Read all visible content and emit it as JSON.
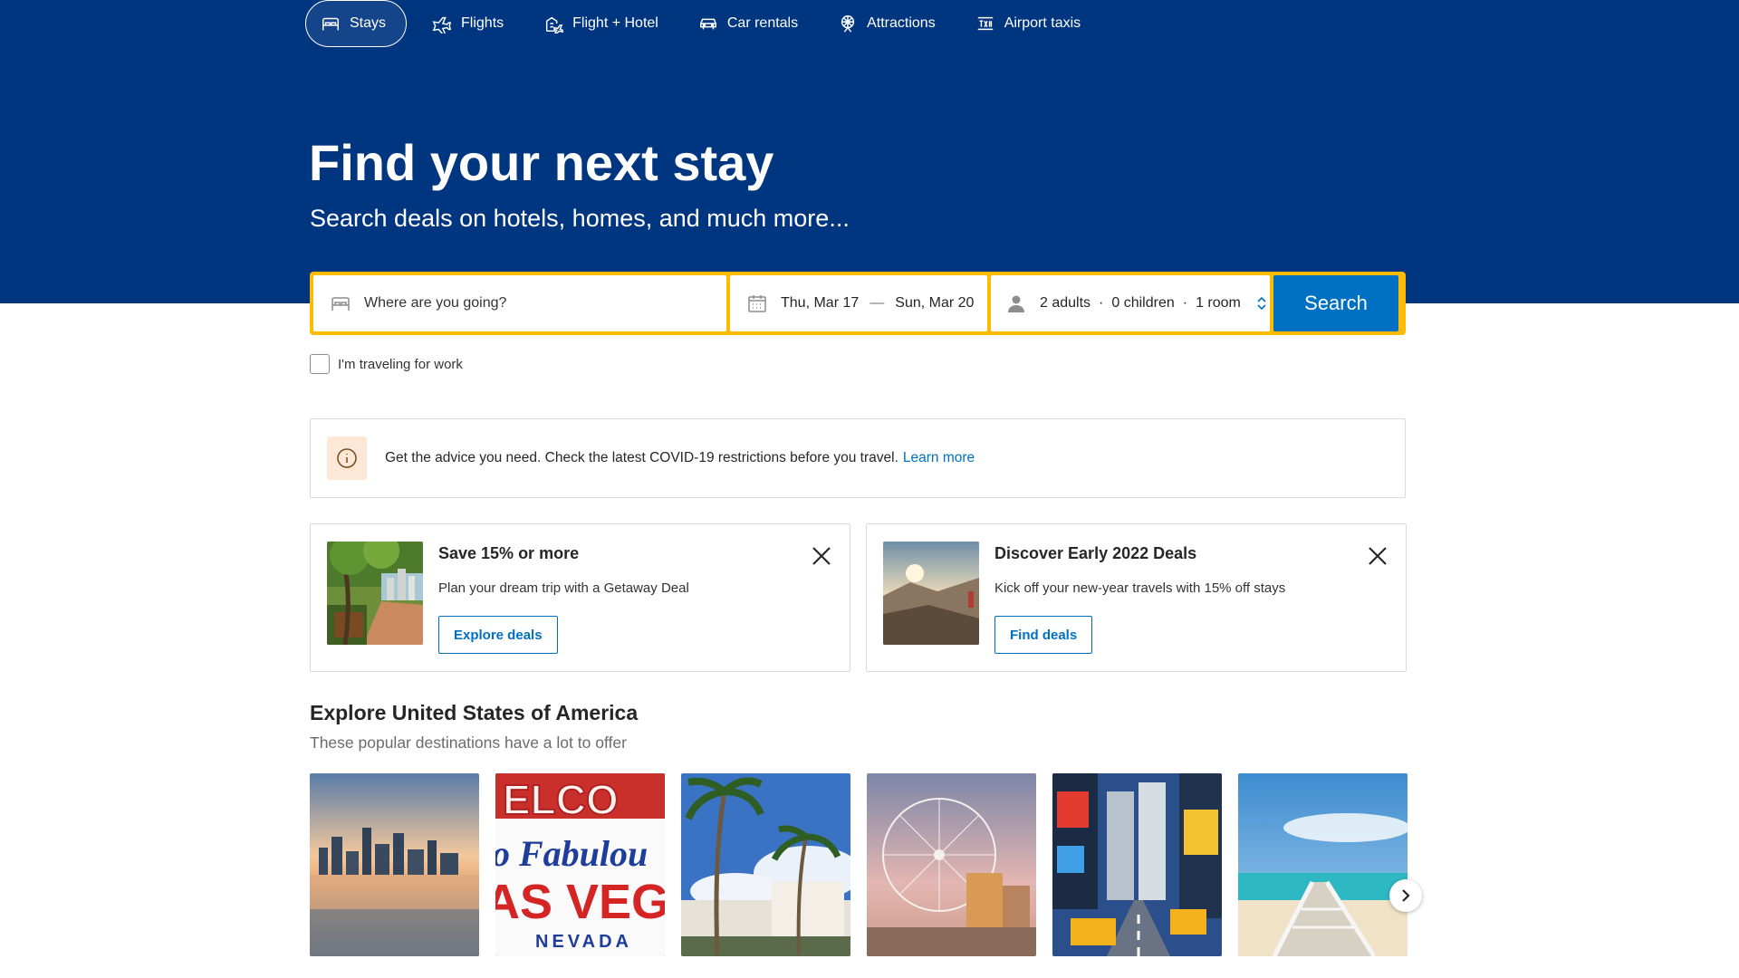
{
  "nav": {
    "items": [
      {
        "label": "Stays",
        "icon": "bed-icon",
        "active": true
      },
      {
        "label": "Flights",
        "icon": "plane-icon"
      },
      {
        "label": "Flight + Hotel",
        "icon": "flight-hotel-icon"
      },
      {
        "label": "Car rentals",
        "icon": "car-icon"
      },
      {
        "label": "Attractions",
        "icon": "attractions-icon"
      },
      {
        "label": "Airport taxis",
        "icon": "taxi-icon"
      }
    ]
  },
  "hero": {
    "title": "Find your next stay",
    "subtitle": "Search deals on hotels, homes, and much more..."
  },
  "search": {
    "destination_placeholder": "Where are you going?",
    "checkin": "Thu, Mar 17",
    "dash": "—",
    "checkout": "Sun, Mar 20",
    "adults": "2 adults",
    "children": "0 children",
    "rooms": "1 room",
    "separator": "·",
    "button_label": "Search"
  },
  "work_travel": {
    "label": "I'm traveling for work",
    "checked": false
  },
  "covid_banner": {
    "text": "Get the advice you need. Check the latest COVID-19 restrictions before you travel.",
    "link": "Learn more"
  },
  "deals": [
    {
      "title": "Save 15% or more",
      "description": "Plan your dream trip with a Getaway Deal",
      "button": "Explore deals"
    },
    {
      "title": "Discover Early 2022 Deals",
      "description": "Kick off your new-year travels with 15% off stays",
      "button": "Find deals"
    }
  ],
  "explore": {
    "title": "Explore United States of America",
    "subtitle": "These popular destinations have a lot to offer"
  },
  "destination_photos": [
    {
      "sign_text": "",
      "sign_lines": []
    },
    {
      "sign_lines": [
        "ELCO",
        "o Fabulou",
        "AS VEG",
        "NEVADA"
      ]
    },
    {},
    {},
    {},
    {}
  ],
  "colors": {
    "brand_navy": "#003580",
    "search_border": "#febb02",
    "primary_blue": "#0071c2"
  }
}
